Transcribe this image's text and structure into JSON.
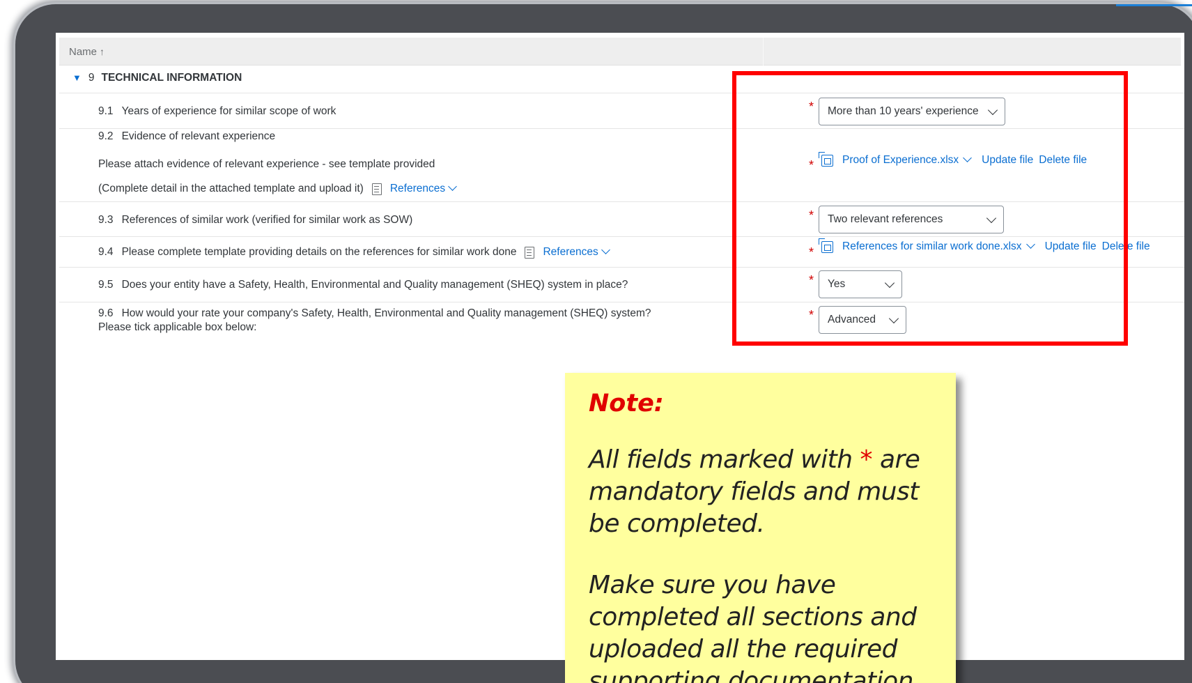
{
  "table": {
    "header_name": "Name",
    "sort_icon": "↑"
  },
  "section": {
    "number": "9",
    "title": "TECHNICAL INFORMATION"
  },
  "questions": [
    {
      "num": "9.1",
      "text": "Years of experience for similar scope of work",
      "answer": "More than 10 years' experience"
    },
    {
      "num": "9.2",
      "text": "Evidence of relevant experience",
      "sub1": "Please attach evidence of relevant experience - see template provided",
      "sub2": "(Complete detail in the attached template and upload it)",
      "references": "References",
      "file": "Proof of Experience.xlsx"
    },
    {
      "num": "9.3",
      "text": "References of similar work (verified for similar work as SOW)",
      "answer": "Two relevant references"
    },
    {
      "num": "9.4",
      "text": "Please complete template providing details on the references for similar work done",
      "references": "References",
      "file": "References for similar work done.xlsx"
    },
    {
      "num": "9.5",
      "text": "Does your entity have a Safety, Health, Environmental and Quality management (SHEQ) system in place?",
      "answer": "Yes"
    },
    {
      "num": "9.6",
      "text": "How would your rate your company's Safety, Health, Environmental and Quality management (SHEQ) system?",
      "sub1": "Please tick applicable box below:",
      "answer": "Advanced"
    }
  ],
  "file_actions": {
    "update": "Update file",
    "delete": "Delete file"
  },
  "required_marker": "*",
  "note": {
    "title": "Note:",
    "line1_pre": "All fields marked with ",
    "line1_star": "*",
    "line1_post": " are mandatory fields and must be completed.",
    "line2": "Make sure you have completed all sections and uploaded all the required supporting documentation."
  },
  "colors": {
    "link": "#0a6ed1",
    "required": "#d10000",
    "highlight": "#ff0000",
    "note_bg": "#ffff9e"
  }
}
